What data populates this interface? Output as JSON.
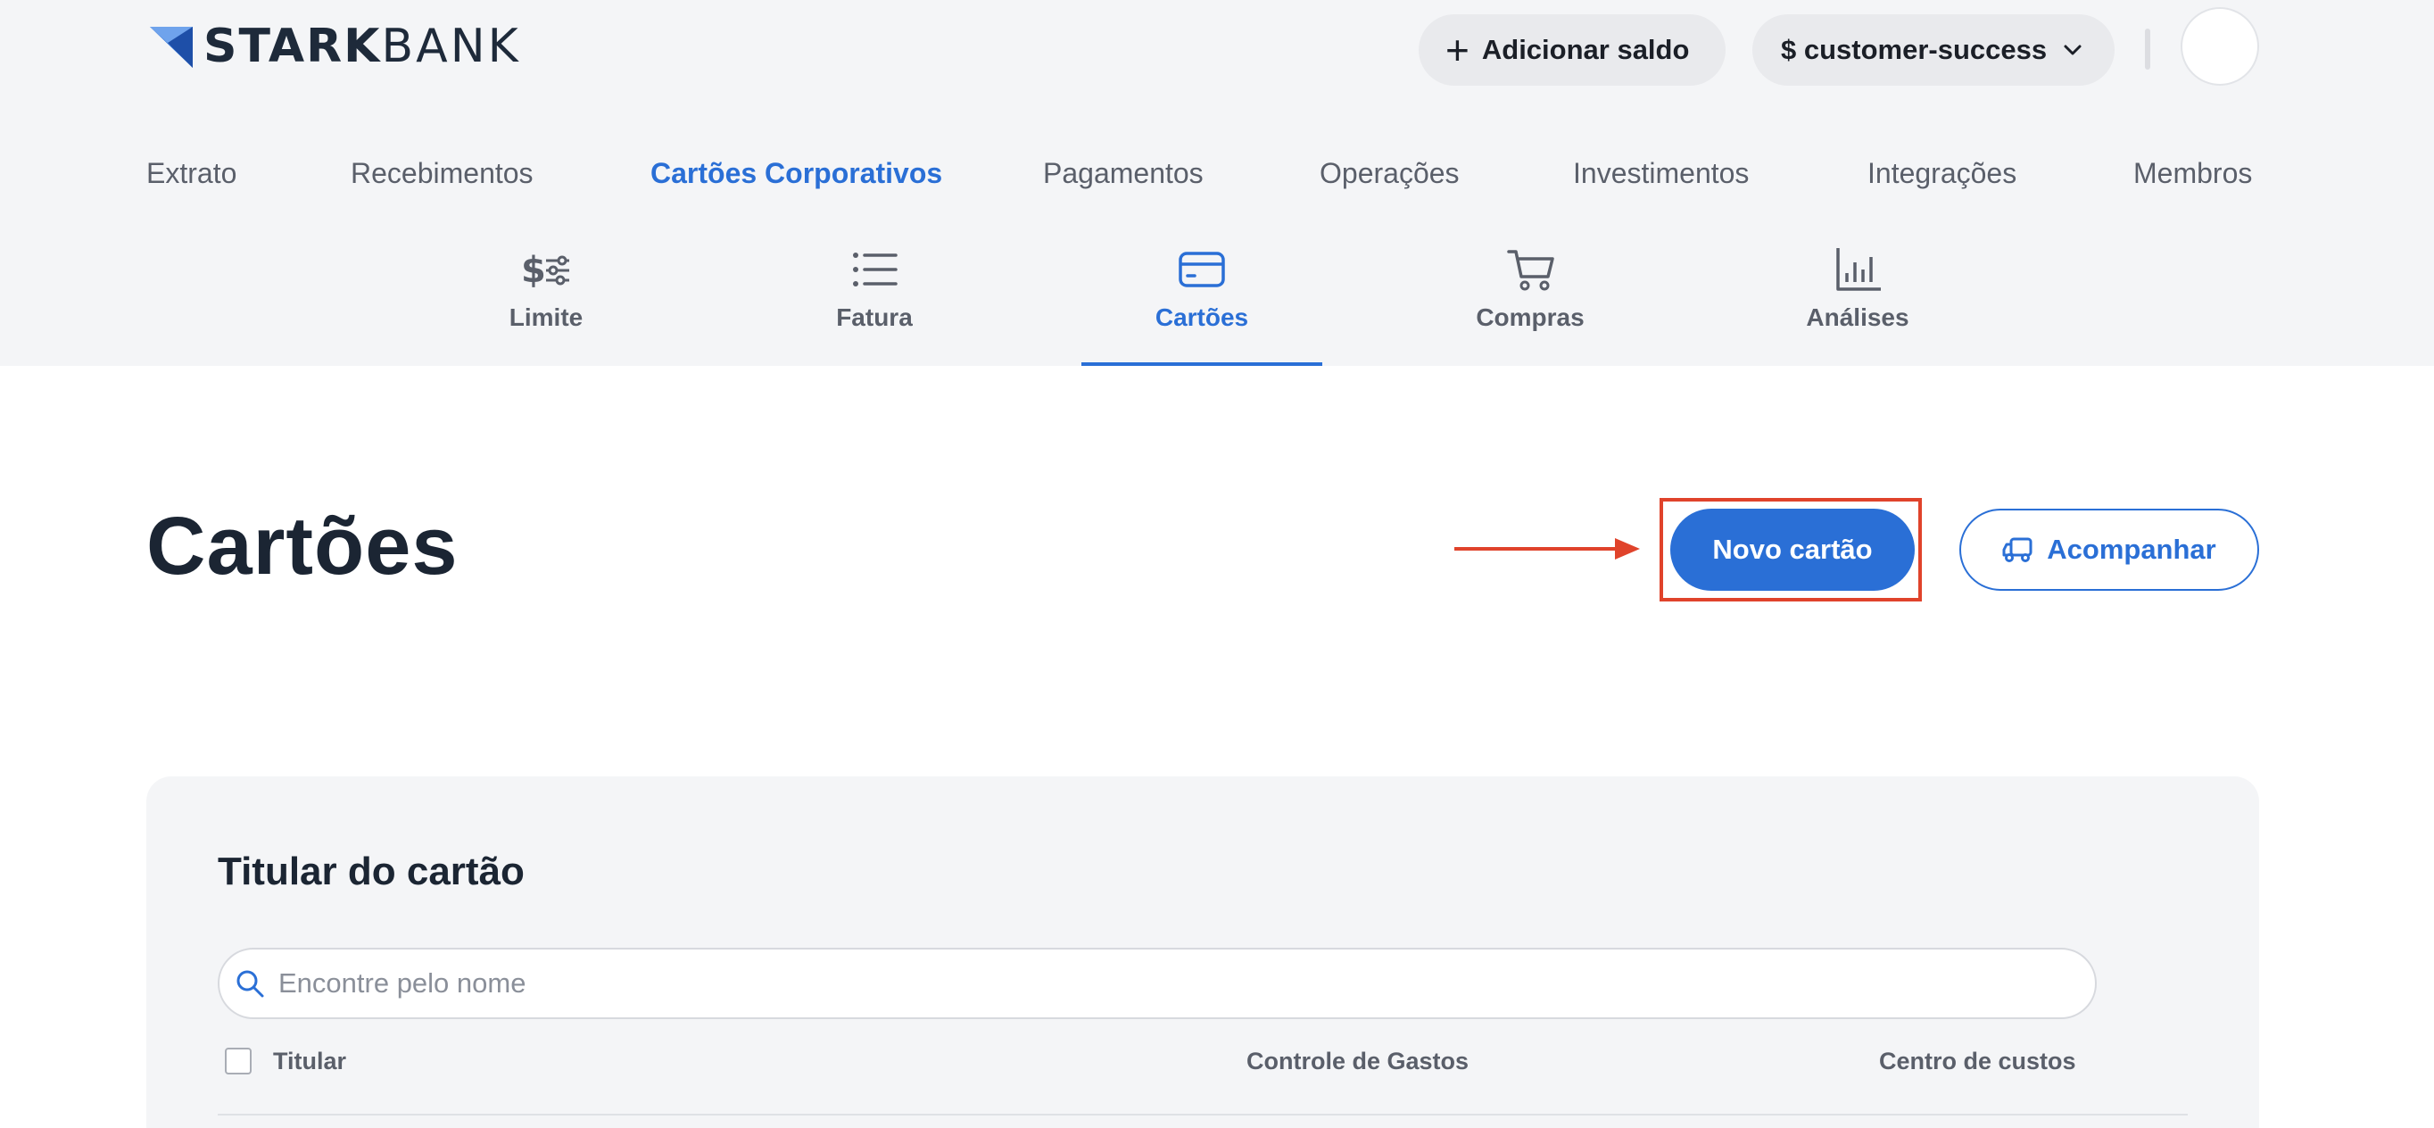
{
  "header": {
    "logo_strong": "STARK",
    "logo_light": "BANK",
    "add_balance_label": "Adicionar saldo",
    "account_label": "$ customer-success"
  },
  "main_nav": [
    {
      "label": "Extrato",
      "active": false
    },
    {
      "label": "Recebimentos",
      "active": false
    },
    {
      "label": "Cartões Corporativos",
      "active": true
    },
    {
      "label": "Pagamentos",
      "active": false
    },
    {
      "label": "Operações",
      "active": false
    },
    {
      "label": "Investimentos",
      "active": false
    },
    {
      "label": "Integrações",
      "active": false
    },
    {
      "label": "Membros",
      "active": false
    }
  ],
  "sub_nav": [
    {
      "label": "Limite",
      "icon": "dollar-sliders-icon",
      "active": false
    },
    {
      "label": "Fatura",
      "icon": "list-icon",
      "active": false
    },
    {
      "label": "Cartões",
      "icon": "credit-card-icon",
      "active": true
    },
    {
      "label": "Compras",
      "icon": "cart-icon",
      "active": false
    },
    {
      "label": "Análises",
      "icon": "bar-chart-icon",
      "active": false
    }
  ],
  "page": {
    "title": "Cartões",
    "new_card_label": "Novo cartão",
    "track_label": "Acompanhar"
  },
  "filter": {
    "title": "Titular do cartão",
    "search_placeholder": "Encontre pelo nome",
    "search_value": ""
  },
  "table": {
    "columns": [
      "Titular",
      "Controle de Gastos",
      "Centro de custos"
    ]
  },
  "colors": {
    "accent": "#2a6fd6",
    "highlight": "#e0432b",
    "header_bg": "#f4f5f7"
  }
}
